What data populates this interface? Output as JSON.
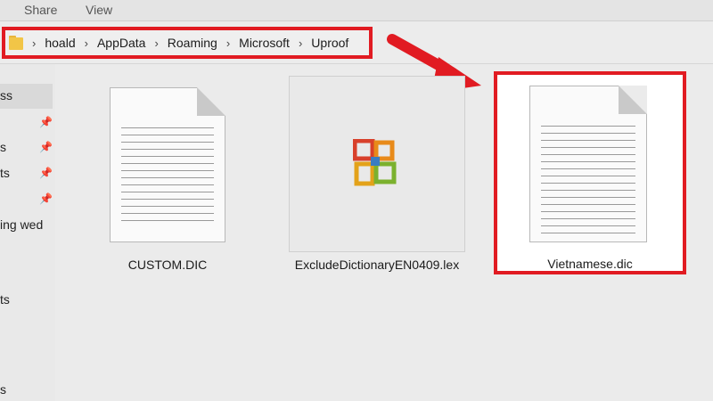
{
  "menu": {
    "share": "Share",
    "view": "View"
  },
  "breadcrumb": {
    "items": [
      "hoald",
      "AppData",
      "Roaming",
      "Microsoft",
      "Uproof"
    ],
    "separator": "›"
  },
  "nav": {
    "items": [
      "ss",
      "s",
      "ts",
      "ing wed",
      "ts",
      "s"
    ]
  },
  "files": [
    {
      "name": "CUSTOM.DIC",
      "icon": "text-document-icon"
    },
    {
      "name": "ExcludeDictionaryEN0409.lex",
      "icon": "office-logo-icon"
    },
    {
      "name": "Vietnamese.dic",
      "icon": "text-document-icon"
    }
  ],
  "colors": {
    "highlight": "#e11b22",
    "folder": "#f2c547"
  }
}
